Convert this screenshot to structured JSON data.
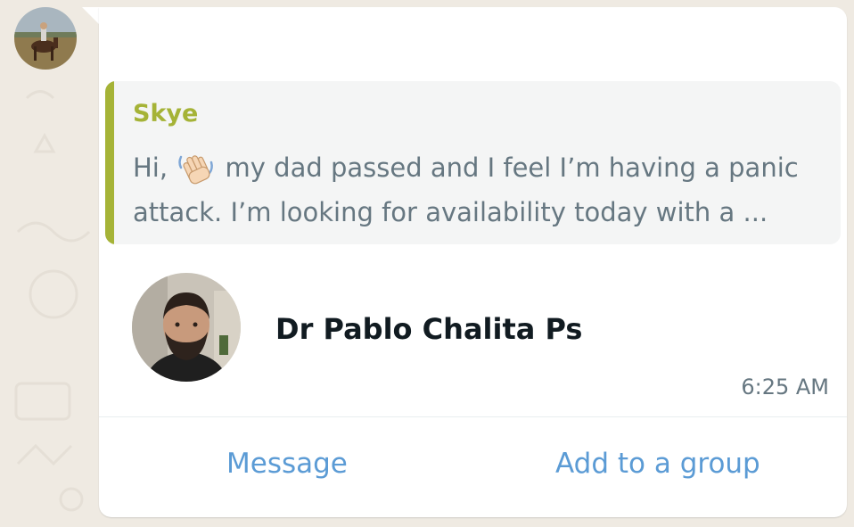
{
  "quoted_message": {
    "author": "Skye",
    "text_before_emoji": "Hi, ",
    "emoji": "waving-hand",
    "text_after_emoji": " my dad passed and I feel I’m having a panic attack. I’m looking for availability today with a ...",
    "accent_color": "#a5b337"
  },
  "contact_card": {
    "name": "Dr Pablo Chalita Ps",
    "time": "6:25 AM"
  },
  "actions": {
    "message_label": "Message",
    "add_to_group_label": "Add to a group",
    "link_color": "#5b9bd5"
  }
}
